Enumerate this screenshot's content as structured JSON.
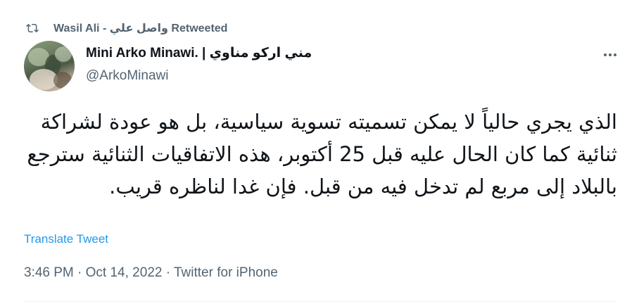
{
  "retweet": {
    "label": "Wasil Ali - واصل علي Retweeted",
    "icon": "retweet-icon"
  },
  "author": {
    "display_name": "Mini Arko Minawi. | مني اركو مناوي",
    "handle": "@ArkoMinawi"
  },
  "menu": {
    "icon": "more-options-icon"
  },
  "tweet": {
    "text": "الذي يجري حالياً لا يمكن تسميته تسوية سياسية، بل هو عودة لشراكة ثنائية كما كان الحال عليه قبل 25 أكتوبر، هذه الاتفاقيات الثنائية سترجع بالبلاد إلى مربع لم تدخل فيه من قبل. فإن غدا لناظره قريب.",
    "translate_label": "Translate Tweet"
  },
  "meta": {
    "time": "3:46 PM",
    "date": "Oct 14, 2022",
    "source": "Twitter for iPhone",
    "separator": " · "
  },
  "colors": {
    "text_primary": "#0f1419",
    "text_secondary": "#536471",
    "link": "#1d9bf0",
    "divider": "#eff3f4"
  }
}
